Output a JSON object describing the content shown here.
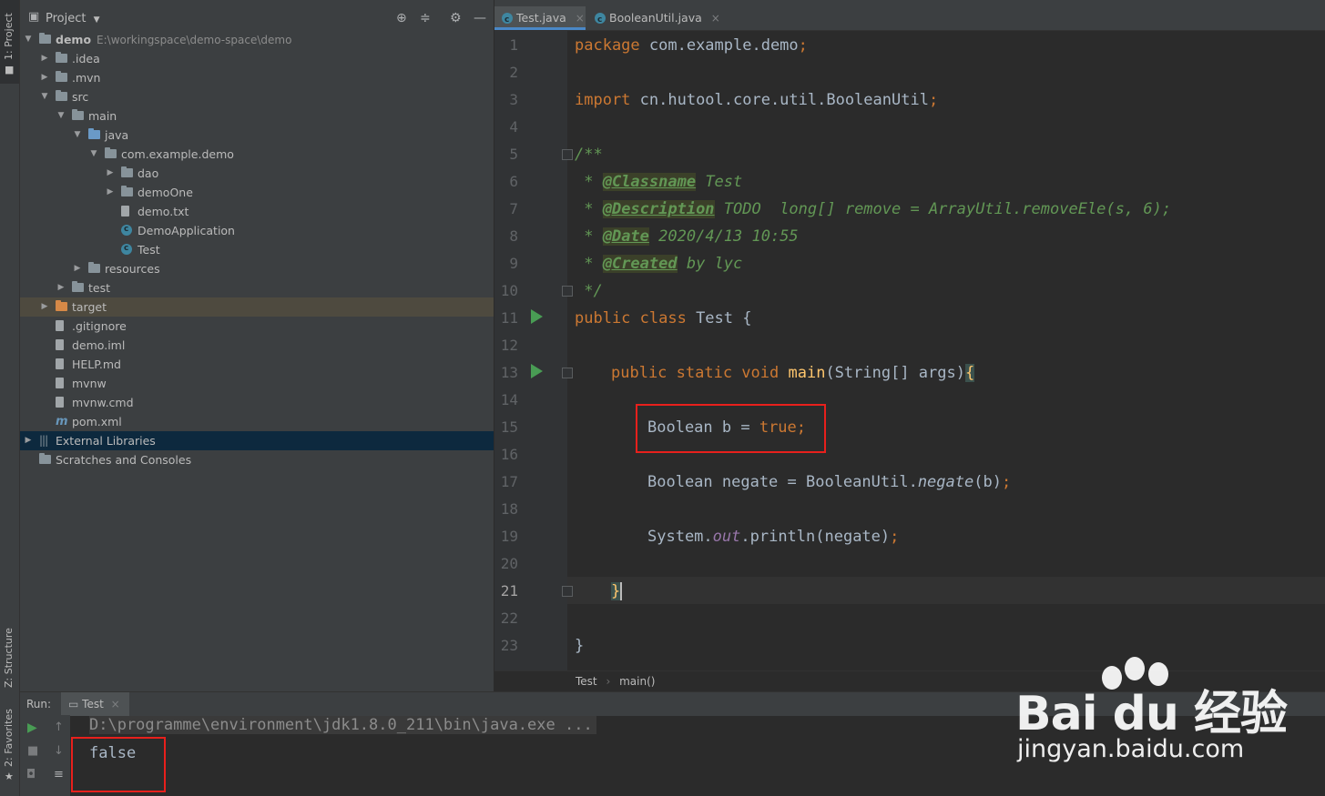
{
  "sidebar": {
    "project_tab": "1: Project",
    "structure_tab": "Z: Structure",
    "favorites_tab": "2: Favorites"
  },
  "project": {
    "title": "Project",
    "tree": [
      {
        "label": "demo",
        "path": "E:\\workingspace\\demo-space\\demo",
        "depth": 0,
        "arrow": "down",
        "icon": "folder"
      },
      {
        "label": ".idea",
        "depth": 1,
        "arrow": "right",
        "icon": "folder"
      },
      {
        "label": ".mvn",
        "depth": 1,
        "arrow": "right",
        "icon": "folder"
      },
      {
        "label": "src",
        "depth": 1,
        "arrow": "down",
        "icon": "folder"
      },
      {
        "label": "main",
        "depth": 2,
        "arrow": "down",
        "icon": "folder"
      },
      {
        "label": "java",
        "depth": 3,
        "arrow": "down",
        "icon": "folder-blue"
      },
      {
        "label": "com.example.demo",
        "depth": 4,
        "arrow": "down",
        "icon": "folder"
      },
      {
        "label": "dao",
        "depth": 5,
        "arrow": "right",
        "icon": "folder"
      },
      {
        "label": "demoOne",
        "depth": 5,
        "arrow": "right",
        "icon": "folder"
      },
      {
        "label": "demo.txt",
        "depth": 5,
        "arrow": "",
        "icon": "file"
      },
      {
        "label": "DemoApplication",
        "depth": 5,
        "arrow": "",
        "icon": "class"
      },
      {
        "label": "Test",
        "depth": 5,
        "arrow": "",
        "icon": "class"
      },
      {
        "label": "resources",
        "depth": 3,
        "arrow": "right",
        "icon": "folder"
      },
      {
        "label": "test",
        "depth": 2,
        "arrow": "right",
        "icon": "folder"
      },
      {
        "label": "target",
        "depth": 1,
        "arrow": "right",
        "icon": "folder-orange",
        "highlight": "target"
      },
      {
        "label": ".gitignore",
        "depth": 1,
        "arrow": "",
        "icon": "file"
      },
      {
        "label": "demo.iml",
        "depth": 1,
        "arrow": "",
        "icon": "file"
      },
      {
        "label": "HELP.md",
        "depth": 1,
        "arrow": "",
        "icon": "file"
      },
      {
        "label": "mvnw",
        "depth": 1,
        "arrow": "",
        "icon": "file"
      },
      {
        "label": "mvnw.cmd",
        "depth": 1,
        "arrow": "",
        "icon": "file"
      },
      {
        "label": "pom.xml",
        "depth": 1,
        "arrow": "",
        "icon": "maven"
      },
      {
        "label": "External Libraries",
        "depth": 0,
        "arrow": "right",
        "icon": "library",
        "highlight": "ext"
      },
      {
        "label": "Scratches and Consoles",
        "depth": 0,
        "arrow": "",
        "icon": "scratch"
      }
    ]
  },
  "editor": {
    "tabs": [
      {
        "label": "Test.java",
        "active": true
      },
      {
        "label": "BooleanUtil.java",
        "active": false
      }
    ],
    "close_glyph": "×",
    "line_numbers": [
      "1",
      "2",
      "3",
      "4",
      "5",
      "6",
      "7",
      "8",
      "9",
      "10",
      "11",
      "12",
      "13",
      "14",
      "15",
      "16",
      "17",
      "18",
      "19",
      "20",
      "21",
      "22",
      "23"
    ],
    "current_line": "21",
    "code": {
      "l1_kw": "package",
      "l1_rest": " com.example.demo",
      "l3_kw": "import",
      "l3_rest": " cn.hutool.core.util.BooleanUtil",
      "semi": ";",
      "l5": "/**",
      "star": " * ",
      "l6_tag": "@Classname",
      "l6_text": " Test",
      "l7_tag": "@Description",
      "l7_text": " TODO  long[] remove = ArrayUtil.removeEle(s, 6);",
      "l8_tag": "@Date",
      "l8_text": " 2020/4/13 10:55",
      "l9_tag": "@Created",
      "l9_text": " by lyc",
      "l10": " */",
      "l11_kw": "public class",
      "l11_rest": " Test {",
      "l13_kw": "public static void",
      "l13_fn": "main",
      "l13_rest": "(String[] args)",
      "brace_open": "{",
      "l15_a": "Boolean b = ",
      "l15_kw": "true",
      "l17_a": "Boolean negate = BooleanUtil.",
      "l17_it": "negate",
      "l17_b": "(b)",
      "l19_a": "System.",
      "l19_st": "out",
      "l19_b": ".println(negate)",
      "l21": "}",
      "l23": "}"
    },
    "breadcrumb": [
      "Test",
      "main()"
    ],
    "breadcrumb_sep": "›"
  },
  "run": {
    "label": "Run:",
    "tab": "Test",
    "command": "D:\\programme\\environment\\jdk1.8.0_211\\bin\\java.exe ...",
    "output": "false"
  },
  "watermark": {
    "logo": "Bai  du 经验",
    "url": "jingyan.baidu.com"
  }
}
